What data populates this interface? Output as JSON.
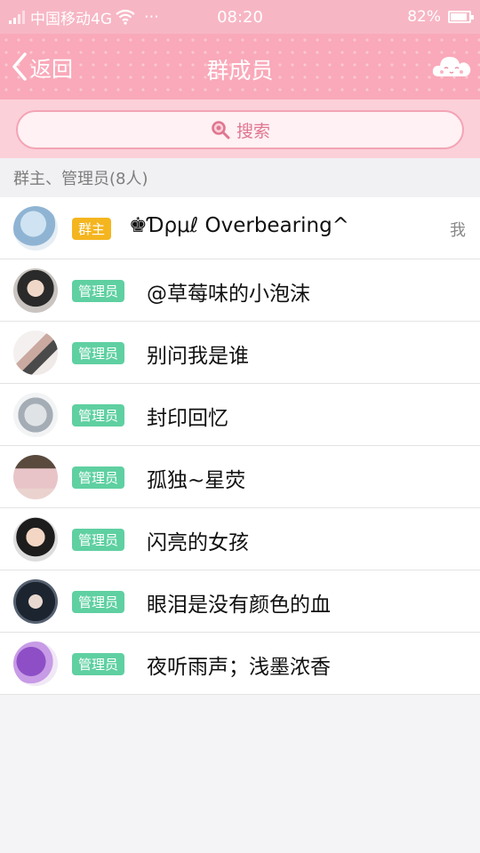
{
  "status_bar": {
    "carrier": "中国移动4G",
    "time": "08:20",
    "battery": "82%"
  },
  "nav": {
    "back_label": "返回",
    "title": "群成员"
  },
  "search": {
    "placeholder": "搜索"
  },
  "section_title": "群主、管理员(8人)",
  "members": [
    {
      "role": "群主",
      "name": "♚Ɗρμℓ  Overbearing^",
      "self_tag": "我"
    },
    {
      "role": "管理员",
      "name": "@草莓味的小泡沫"
    },
    {
      "role": "管理员",
      "name": "别问我是谁"
    },
    {
      "role": "管理员",
      "name": "封印回忆"
    },
    {
      "role": "管理员",
      "name": "孤独~星荧"
    },
    {
      "role": "管理员",
      "name": "闪亮的女孩"
    },
    {
      "role": "管理员",
      "name": "眼泪是没有颜色的血"
    },
    {
      "role": "管理员",
      "name": "夜听雨声；浅墨浓香"
    }
  ],
  "colors": {
    "nav_pink": "#f9a9b9",
    "owner_badge": "#f4b51f",
    "admin_badge": "#5fd0a1"
  }
}
